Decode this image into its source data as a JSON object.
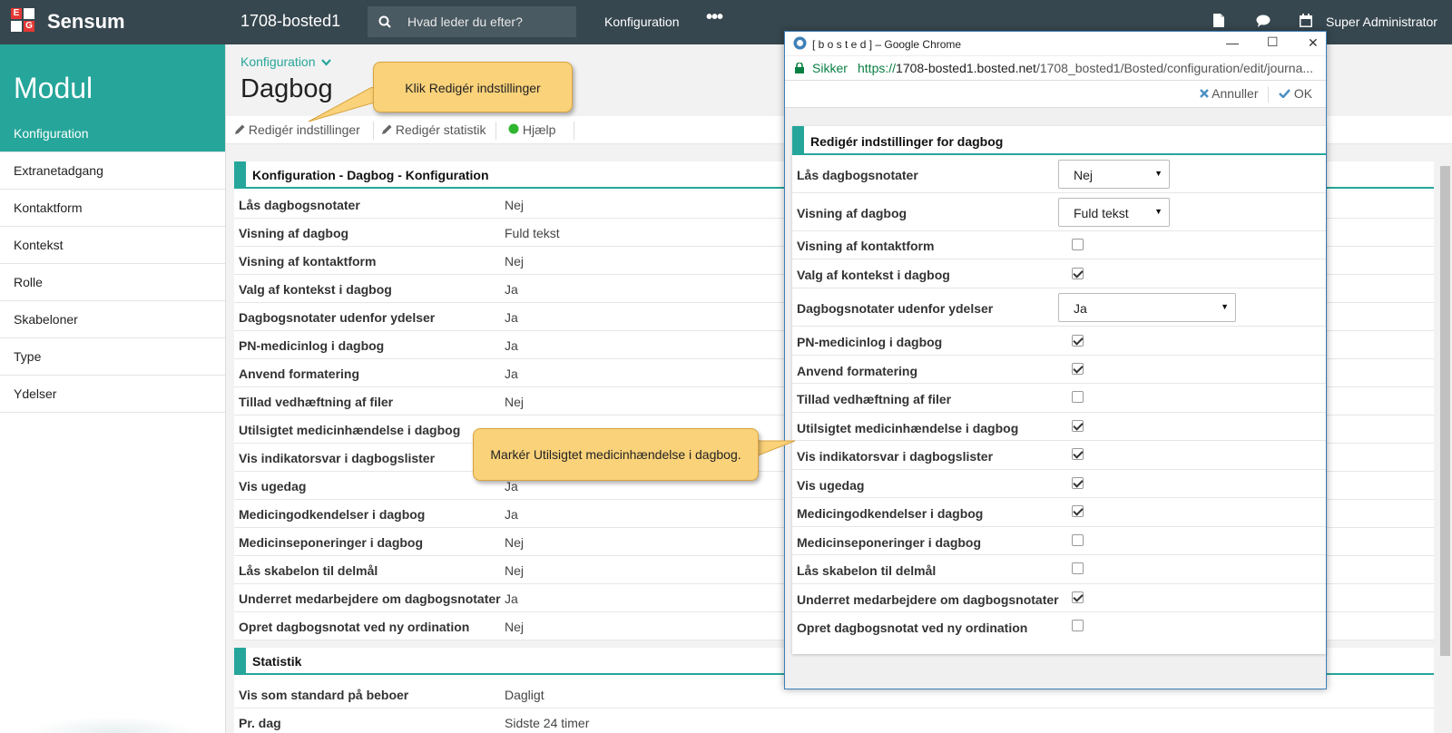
{
  "topbar": {
    "brand": "Sensum",
    "logo_letters": [
      "E",
      "G"
    ],
    "site": "1708-bosted1",
    "search_placeholder": "Hvad leder du efter?",
    "nav": "Konfiguration",
    "more": "•••",
    "icons": [
      "document-icon",
      "chat-icon",
      "calendar-icon"
    ],
    "user": "Super Administrator",
    "colors": {
      "bar": "#37474f",
      "accent": "#26a69a",
      "logo_red": "#e53935"
    }
  },
  "sidebar": {
    "title": "Modul",
    "items": [
      {
        "label": "Konfiguration",
        "active": true
      },
      {
        "label": "Extranetadgang"
      },
      {
        "label": "Kontaktform"
      },
      {
        "label": "Kontekst"
      },
      {
        "label": "Rolle"
      },
      {
        "label": "Skabeloner"
      },
      {
        "label": "Type"
      },
      {
        "label": "Ydelser"
      }
    ]
  },
  "page": {
    "breadcrumb": "Konfiguration",
    "title": "Dagbog",
    "toolbar": {
      "edit_settings": "Redigér indstillinger",
      "edit_stats": "Redigér statistik",
      "help": "Hjælp"
    }
  },
  "config": {
    "header": "Konfiguration - Dagbog - Konfiguration",
    "rows": [
      {
        "label": "Lås dagbogsnotater",
        "value": "Nej"
      },
      {
        "label": "Visning af dagbog",
        "value": "Fuld tekst"
      },
      {
        "label": "Visning af kontaktform",
        "value": "Nej"
      },
      {
        "label": "Valg af kontekst i dagbog",
        "value": "Ja"
      },
      {
        "label": "Dagbogsnotater udenfor ydelser",
        "value": "Ja"
      },
      {
        "label": "PN-medicinlog i dagbog",
        "value": "Ja"
      },
      {
        "label": "Anvend formatering",
        "value": "Ja"
      },
      {
        "label": "Tillad vedhæftning af filer",
        "value": "Nej"
      },
      {
        "label": "Utilsigtet medicinhændelse i dagbog",
        "value": ""
      },
      {
        "label": "Vis indikatorsvar i dagbogslister",
        "value": ""
      },
      {
        "label": "Vis ugedag",
        "value": "Ja"
      },
      {
        "label": "Medicingodkendelser i dagbog",
        "value": "Ja"
      },
      {
        "label": "Medicinseponeringer i dagbog",
        "value": "Nej"
      },
      {
        "label": "Lås skabelon til delmål",
        "value": "Nej"
      },
      {
        "label": "Underret medarbejdere om dagbogsnotater",
        "value": "Ja"
      },
      {
        "label": "Opret dagbogsnotat ved ny ordination",
        "value": "Nej"
      }
    ]
  },
  "stats": {
    "header": "Statistik",
    "rows": [
      {
        "label": "Vis som standard på beboer",
        "value": "Dagligt"
      },
      {
        "label": "Pr. dag",
        "value": "Sidste 24 timer"
      }
    ]
  },
  "popup": {
    "window_title": "[ b o s t e d ] – Google Chrome",
    "controls": {
      "minimize": "—",
      "maximize": "☐",
      "close": "✕"
    },
    "secure": "Sikker",
    "url_scheme": "https://",
    "url_host": "1708-bosted1.bosted.net",
    "url_path": "/1708_bosted1/Bosted/configuration/edit/journa...",
    "cancel": "Annuller",
    "ok": "OK",
    "form_title": "Redigér indstillinger for dagbog",
    "fields": [
      {
        "label": "Lås dagbogsnotater",
        "type": "select",
        "value": "Nej"
      },
      {
        "label": "Visning af dagbog",
        "type": "select",
        "value": "Fuld tekst"
      },
      {
        "label": "Visning af kontaktform",
        "type": "checkbox",
        "checked": false
      },
      {
        "label": "Valg af kontekst i dagbog",
        "type": "checkbox",
        "checked": true
      },
      {
        "label": "Dagbogsnotater udenfor ydelser",
        "type": "select",
        "value": "Ja"
      },
      {
        "label": "PN-medicinlog i dagbog",
        "type": "checkbox",
        "checked": true
      },
      {
        "label": "Anvend formatering",
        "type": "checkbox",
        "checked": true
      },
      {
        "label": "Tillad vedhæftning af filer",
        "type": "checkbox",
        "checked": false
      },
      {
        "label": "Utilsigtet medicinhændelse i dagbog",
        "type": "checkbox",
        "checked": true
      },
      {
        "label": "Vis indikatorsvar i dagbogslister",
        "type": "checkbox",
        "checked": true
      },
      {
        "label": "Vis ugedag",
        "type": "checkbox",
        "checked": true
      },
      {
        "label": "Medicingodkendelser i dagbog",
        "type": "checkbox",
        "checked": true
      },
      {
        "label": "Medicinseponeringer i dagbog",
        "type": "checkbox",
        "checked": false
      },
      {
        "label": "Lås skabelon til delmål",
        "type": "checkbox",
        "checked": false
      },
      {
        "label": "Underret medarbejdere om dagbogsnotater",
        "type": "checkbox",
        "checked": true
      },
      {
        "label": "Opret dagbogsnotat ved ny ordination",
        "type": "checkbox",
        "checked": false
      }
    ]
  },
  "callouts": {
    "edit": "Klik Redigér indstillinger",
    "mark": "Markér Utilsigtet medicinhændelse i dagbog."
  }
}
